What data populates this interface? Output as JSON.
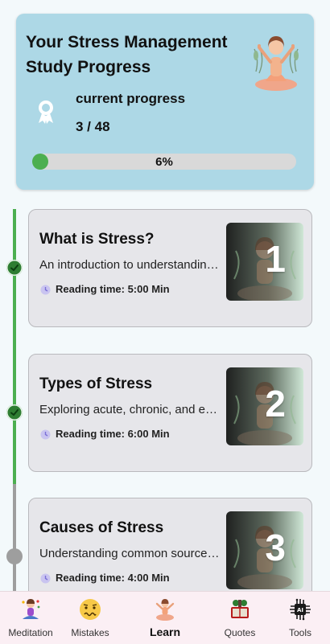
{
  "header": {
    "title": "Your Stress Management Study Progress",
    "progress_label": "current progress",
    "progress_count": "3 / 48",
    "progress_percent_text": "6%",
    "progress_fraction": 0.0625,
    "progress_color": "#4caf50",
    "card_color": "#add8e6"
  },
  "lessons": [
    {
      "number": "1",
      "title": "What is Stress?",
      "description": "An introduction to understanding stress",
      "reading_time": "Reading time: 5:00 Min",
      "status": "completed"
    },
    {
      "number": "2",
      "title": "Types of Stress",
      "description": "Exploring acute, chronic, and episodic stress",
      "reading_time": "Reading time: 6:00 Min",
      "status": "completed"
    },
    {
      "number": "3",
      "title": "Causes of Stress",
      "description": "Understanding common sources of stress",
      "reading_time": "Reading time: 4:00 Min",
      "status": "pending"
    }
  ],
  "nav": {
    "items": [
      {
        "label": "Meditation",
        "icon": "meditation-icon",
        "active": false
      },
      {
        "label": "Mistakes",
        "icon": "worried-face-icon",
        "active": false
      },
      {
        "label": "Learn",
        "icon": "meditating-person-icon",
        "active": true
      },
      {
        "label": "Quotes",
        "icon": "book-icon",
        "active": false
      },
      {
        "label": "Tools",
        "icon": "ai-chip-icon",
        "active": false
      }
    ]
  }
}
